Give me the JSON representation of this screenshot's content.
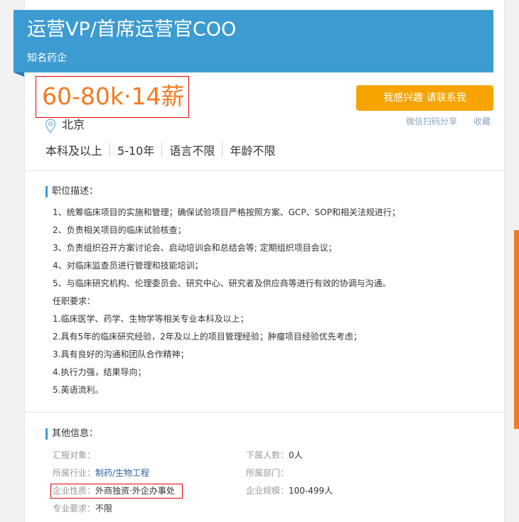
{
  "header": {
    "job_title": "运营VP/首席运营官COO",
    "company": "知名药企"
  },
  "salary": "60-80k·14薪",
  "location": "北京",
  "requirements": [
    "本科及以上",
    "5-10年",
    "语言不限",
    "年龄不限"
  ],
  "actions": {
    "apply_label": "我感兴趣 请联系我",
    "share_label": "微信扫码分享",
    "favorite_label": "收藏"
  },
  "description": {
    "title": "职位描述：",
    "lines": [
      "1、统筹临床项目的实施和管理；确保试验项目严格按照方案、GCP、SOP和相关法规进行；",
      "2、负责相关项目的临床试验核查；",
      "3、负责组织召开方案讨论会、启动培训会和总结会等; 定期组织项目会议；",
      "4、对临床监查员进行管理和技能培训；",
      "5、与临床研究机构、伦理委员会、研究中心、研究者及供应商等进行有效的协调与沟通。",
      "任职要求：",
      "1.临床医学、药学、生物学等相关专业本科及以上；",
      "2.具有5年的临床研究经验，2年及以上的项目管理经验；肿瘤项目经验优先考虑；",
      "3.具有良好的沟通和团队合作精神；",
      "4.执行力强，结果导向；",
      "5.英语流利。"
    ]
  },
  "other_info": {
    "title": "其他信息：",
    "left": [
      {
        "label": "汇报对象：",
        "value": ""
      },
      {
        "label": "所属行业：",
        "value": "制药/生物工程"
      },
      {
        "label": "企业性质：",
        "value": "外商独资·外企办事处"
      },
      {
        "label": "专业要求：",
        "value": "不限"
      }
    ],
    "right": [
      {
        "label": "下属人数：",
        "value": "0人"
      },
      {
        "label": "所属部门：",
        "value": ""
      },
      {
        "label": "企业规模：",
        "value": "100-499人"
      }
    ]
  }
}
